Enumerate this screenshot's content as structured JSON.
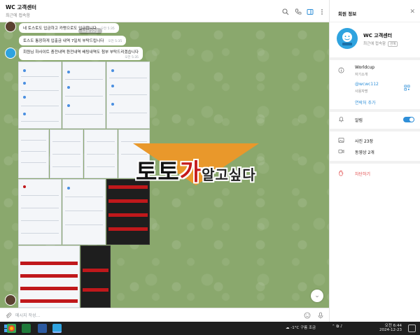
{
  "header": {
    "title": "WC 고객센터",
    "status": "최근에 접속함"
  },
  "messages": {
    "m1": "네 토스토도 입금하고 카랭으로도 입금합니다",
    "m1_time": "오전 5:35",
    "m2": "토스도 통장하게 입출금 내역 7일치 부탁드립니다",
    "m2_time": "오전 5:35",
    "m3": "회원님 하사이트 충전내역 환전내역 배팅내역도 첨부 부탁드리겠습니다",
    "m3_time": "오전 5:35",
    "date_pill": "12월 22일"
  },
  "composer": {
    "placeholder": "메시지 작성..."
  },
  "watermark": {
    "part1": "토토",
    "part2": "가",
    "part3": "알고싶다"
  },
  "info_panel": {
    "title": "회원 정보",
    "name": "WC 고객센터",
    "status": "최근에 접속함",
    "badge": "관계",
    "bio_value": "Worldcup",
    "bio_label": "자기소개",
    "username_value": "@wcwc112",
    "username_label": "사용자명",
    "add_contact": "연락처 추가",
    "notifications_label": "알림",
    "photos_label": "사진 23장",
    "videos_label": "동영상 2개",
    "block_label": "차단하기"
  },
  "taskbar": {
    "weather": "-1°C 구름 조금",
    "time": "오전 6:44",
    "date": "2024-12-23"
  },
  "colors": {
    "accent": "#2f8fd8",
    "chat_background": "#8aa86d",
    "watermark_orange": "#e9982b",
    "danger": "#e04545"
  }
}
